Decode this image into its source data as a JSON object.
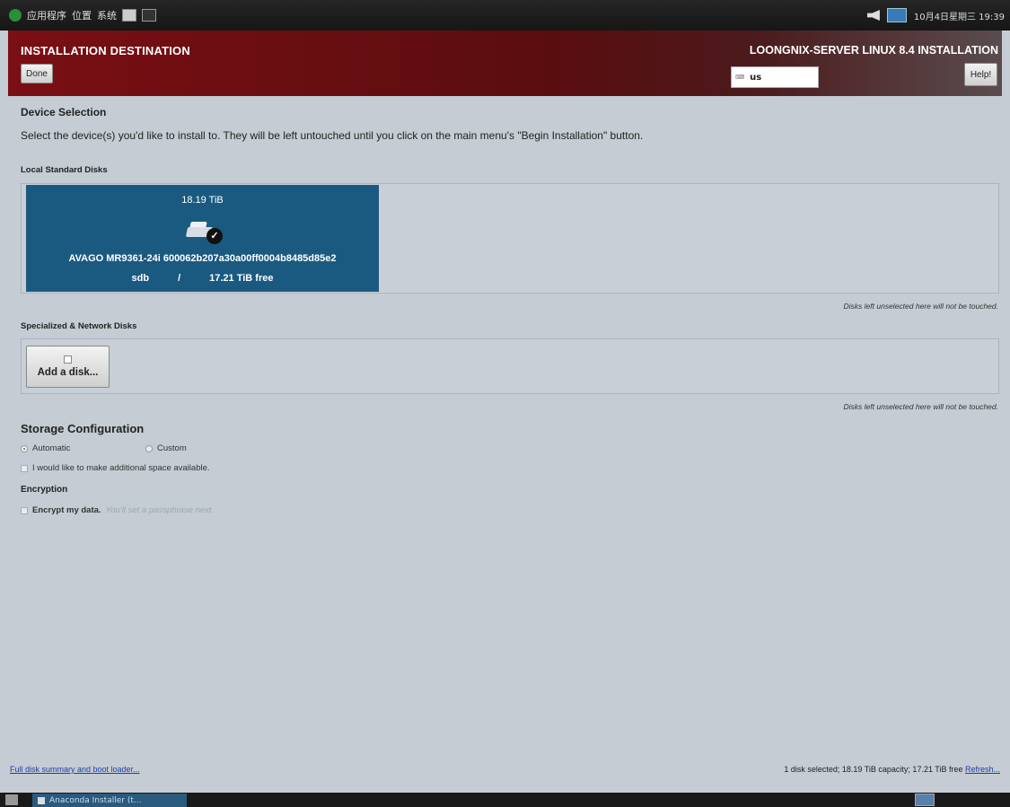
{
  "top_panel": {
    "menus": [
      "应用程序",
      "位置",
      "系统"
    ],
    "clock": "10月4日星期三 19:39"
  },
  "header": {
    "title": "INSTALLATION DESTINATION",
    "done_label": "Done",
    "product": "LOONGNIX-SERVER LINUX 8.4 INSTALLATION",
    "keyboard_layout": "us",
    "help_label": "Help!"
  },
  "device_selection": {
    "title": "Device Selection",
    "description": "Select the device(s) you'd like to install to.  They will be left untouched until you click on the main menu's \"Begin Installation\" button."
  },
  "local_disks": {
    "label": "Local Standard Disks",
    "disk": {
      "size": "18.19 TiB",
      "name": "AVAGO MR9361-24i 600062b207a30a00ff0004b8485d85e2",
      "device": "sdb",
      "mount": "/",
      "free": "17.21 TiB free",
      "selected": true
    },
    "note": "Disks left unselected here will not be touched."
  },
  "network_disks": {
    "label": "Specialized & Network Disks",
    "add_label": "Add a disk...",
    "note": "Disks left unselected here will not be touched."
  },
  "storage": {
    "title": "Storage Configuration",
    "automatic": "Automatic",
    "custom": "Custom",
    "selected": "Automatic",
    "space_option": "I would like to make additional space available."
  },
  "encryption": {
    "title": "Encryption",
    "option": "Encrypt my data.",
    "hint": "You'll set a passphrase next."
  },
  "footer": {
    "summary_link": "Full disk summary and boot loader...",
    "status": "1 disk selected; 18.19 TiB capacity; 17.21 TiB free ",
    "refresh": "Refresh..."
  },
  "taskbar": {
    "task_label": "Anaconda Installer (t..."
  },
  "colors": {
    "header_red": "#7a0f14",
    "disk_selected": "#1b5a80",
    "background": "#c5ccd3",
    "link": "#1a3fa8"
  }
}
